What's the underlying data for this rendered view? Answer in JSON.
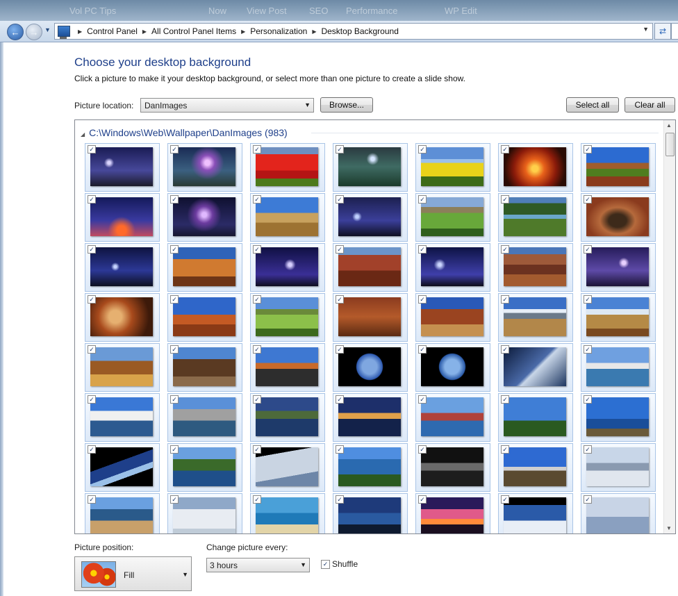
{
  "top_ghost": [
    "Vol PC Tips",
    "Now",
    "View Post",
    "SEO",
    "Performance",
    "WP Edit"
  ],
  "breadcrumb": [
    "Control Panel",
    "All Control Panel Items",
    "Personalization",
    "Desktop Background"
  ],
  "page": {
    "title": "Choose your desktop background",
    "subtitle": "Click a picture to make it your desktop background, or select more than one picture to create a slide show."
  },
  "location": {
    "label": "Picture location:",
    "value": "DanImages",
    "browse": "Browse...",
    "select_all": "Select all",
    "clear_all": "Clear all"
  },
  "gallery": {
    "header": "C:\\Windows\\Web\\Wallpaper\\DanImages (983)",
    "check": "✓",
    "thumbnails": [
      [
        "lightning-storm",
        "lightning-purple-sky",
        "tulip-field",
        "sky-lightning-green",
        "flower-field",
        "sunset-fire-clouds",
        "red-barn-field"
      ],
      [
        "lightning-ocean-sunset",
        "lightning-night-water",
        "wheat-field",
        "lightning-blue-city",
        "golf-course-valley",
        "river-canyon",
        "canyon-bend"
      ],
      [
        "lightning-blue",
        "rock-formation-sunset",
        "lightning-cluster",
        "canyon-red-rocks",
        "lightning-single",
        "grand-canyon",
        "lightning-purple"
      ],
      [
        "red-rock-closeup",
        "monument-valley",
        "green-golf",
        "adobe-ruins",
        "ruins-wagon",
        "mountain-prairie",
        "mountain-barn"
      ],
      [
        "wooden-barn",
        "wild-west-town",
        "desert-road",
        "earth-globe",
        "earth-globe-alt",
        "earth-from-space",
        "harbor-sailboats"
      ],
      [
        "marina-boats",
        "marina-dock",
        "lake-evening",
        "city-harbor-night",
        "fishing-village",
        "chapel-palms",
        "lighthouse-coast"
      ],
      [
        "earth-horizon",
        "coastal-cliff",
        "planet-clouds",
        "coastline-lighthouse",
        "space-shuttle",
        "lighthouse-rocks",
        "shuttle-orbit"
      ],
      [
        "coastal-bay",
        "balloon-clouds",
        "lagoon-beach",
        "sea-stacks",
        "sunset-silhouette",
        "shuttle-earth",
        "shuttle-blue"
      ]
    ]
  },
  "position": {
    "label": "Picture position:",
    "value": "Fill"
  },
  "interval": {
    "label": "Change picture every:",
    "value": "3 hours"
  },
  "shuffle": {
    "label": "Shuffle",
    "checked": true
  }
}
